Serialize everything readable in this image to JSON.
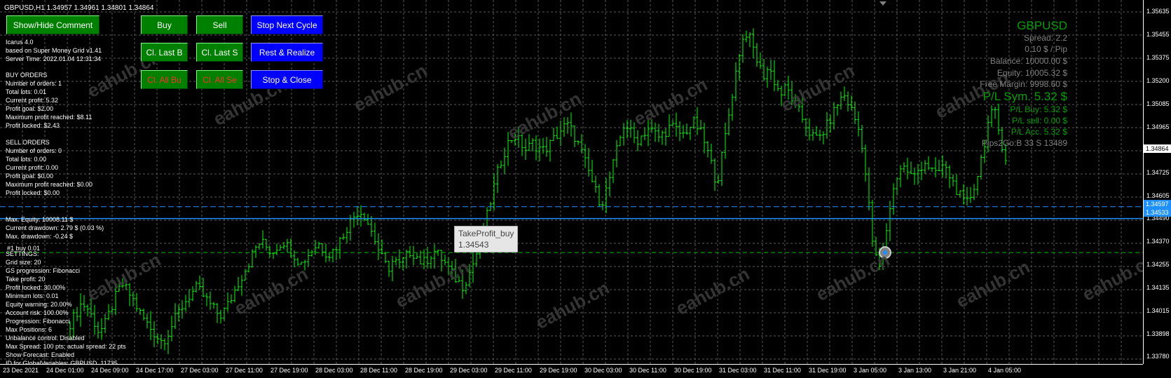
{
  "window": {
    "title": "GBPUSD,H1  1.34957 1.34961 1.34801 1.34864"
  },
  "buttons": {
    "show_hide_comment": "Show/Hide Comment",
    "buy": "Buy",
    "sell": "Sell",
    "stop_next_cycle": "Stop Next Cycle",
    "close_last_buy": "Cl. Last B",
    "close_last_sell": "Cl. Last S",
    "rest_realize": "Rest & Realize",
    "close_all_buy": "Cl. All Bu",
    "close_all_sell": "Cl. All Se",
    "stop_close": "Stop & Close"
  },
  "comment": {
    "header": [
      "Icarus 4.0",
      "based on Super Money Grid v1.41",
      "Server Time: 2022.01.04 12:31:34"
    ],
    "buy_orders": [
      "BUY ORDERS",
      "Number of orders: 1",
      "Total lots: 0.01",
      "Current profit: 5.32",
      "Profit goal: $2.00",
      "Maximum profit reached: $8.11",
      "Profit locked: $2.43"
    ],
    "sell_orders": [
      "SELL ORDERS",
      "Number of orders: 0",
      "Total lots: 0.00",
      "Current profit: 0.00",
      "Profit goal: $0.00",
      "Maximum profit reached: $0.00",
      "Profit locked: $0.00"
    ],
    "equity": [
      "Max. Equity: 10008.11 $",
      "Current drawdown: 2.79 $ (0.03 %)",
      "Max. drawdown: -0.24 $"
    ],
    "order_label": "#1 buy 0.01",
    "settings": [
      "SETTINGS:",
      "Grid size: 20",
      "GS progression: Fibonacci",
      "Take profit: 20",
      "Profit locked: 30.00%",
      "Minimum lots: 0.01",
      "Equity warning: 20.00%",
      "Account risk: 100.00%",
      "Progression: Fibonacci",
      "Max Positions: 6",
      "Unbalance control: Disabled",
      "Max Spread: 100 pts; actual spread: 22 pts",
      "Show Forecast: Enabled",
      "ID for GlobalVariables: GBPUSD_11735"
    ]
  },
  "info_panel": {
    "symbol": "GBPUSD",
    "spread": "Spread: 2.2",
    "pip_value": "0.10 $ / Pip",
    "balance": "Balance: 10000.00 $",
    "equity": "Equity: 10005.32 $",
    "free_margin": "Free Margin: 9998.60 $",
    "pl_sym": "P/L Sym. 5.32 $",
    "pl_buy": "P/L Buy: 5.32 $",
    "pl_sell": "P/L sell: 0.00 $",
    "pl_acc": "P/L Acc. 5.32 $",
    "pips2go": "Pips2Go:B 33 S 13489",
    "colors": {
      "symbol": "#00a000",
      "gray": "#808080",
      "green": "#00a000"
    }
  },
  "tooltip": {
    "title": "TakeProfit_buy",
    "value": "1.34543"
  },
  "watermark": "eahub.cn",
  "price_axis": {
    "ticks": [
      "1.35635",
      "1.35455",
      "1.35375",
      "1.35200",
      "1.35085",
      "1.34965",
      "1.34725",
      "1.34605",
      "1.34490",
      "1.34370",
      "1.34255",
      "1.34135",
      "1.34015",
      "1.33898",
      "1.33780"
    ],
    "current_price": "1.34864",
    "line1_label": "1.34597",
    "line2_label": "1.34533"
  },
  "time_axis": {
    "labels": [
      "23 Dec 2021",
      "24 Dec 01:00",
      "24 Dec 09:00",
      "24 Dec 17:00",
      "27 Dec 03:00",
      "27 Dec 11:00",
      "27 Dec 19:00",
      "28 Dec 03:00",
      "28 Dec 11:00",
      "28 Dec 19:00",
      "29 Dec 03:00",
      "29 Dec 11:00",
      "29 Dec 19:00",
      "30 Dec 03:00",
      "30 Dec 11:00",
      "30 Dec 19:00",
      "31 Dec 03:00",
      "31 Dec 11:00",
      "31 Dec 19:00",
      "3 Jan 05:00",
      "3 Jan 13:00",
      "3 Jan 21:00",
      "4 Jan 05:00"
    ]
  },
  "chart_data": {
    "type": "ohlc",
    "symbol": "GBPUSD",
    "timeframe": "H1",
    "ylim": [
      1.3375,
      1.3571
    ],
    "grid": true,
    "colors": {
      "bars": "#00ff00",
      "grid": "#5a5a5a",
      "line_upper": "#1e90ff",
      "line_lower": "#1e90ff",
      "order_line": "#00c000"
    },
    "levels": {
      "dashed_blue": 1.34597,
      "solid_blue": 1.34533,
      "order_line": 1.3435
    },
    "close_path": [
      1.3397,
      1.3402,
      1.3408,
      1.3405,
      1.3399,
      1.3392,
      1.3396,
      1.3404,
      1.3412,
      1.3418,
      1.3414,
      1.3409,
      1.3403,
      1.3398,
      1.3394,
      1.339,
      1.3387,
      1.3392,
      1.3398,
      1.3404,
      1.3409,
      1.3413,
      1.3416,
      1.3412,
      1.3408,
      1.3404,
      1.3401,
      1.3405,
      1.3411,
      1.3418,
      1.3424,
      1.343,
      1.3437,
      1.3441,
      1.3438,
      1.3435,
      1.3439,
      1.3441,
      1.3437,
      1.3433,
      1.3429,
      1.3433,
      1.3437,
      1.344,
      1.3436,
      1.3434,
      1.3438,
      1.3443,
      1.3449,
      1.3454,
      1.3458,
      1.3455,
      1.3448,
      1.344,
      1.3432,
      1.3426,
      1.3431,
      1.3428,
      1.3432,
      1.3436,
      1.3433,
      1.3429,
      1.3432,
      1.3436,
      1.3433,
      1.3429,
      1.3424,
      1.342,
      1.3417,
      1.3423,
      1.3431,
      1.344,
      1.3452,
      1.3465,
      1.3478,
      1.3488,
      1.3495,
      1.3498,
      1.3494,
      1.349,
      1.3494,
      1.3492,
      1.349,
      1.3493,
      1.3497,
      1.3501,
      1.3504,
      1.35,
      1.3493,
      1.3485,
      1.3477,
      1.3468,
      1.3461,
      1.347,
      1.3482,
      1.3494,
      1.3505,
      1.35,
      1.3495,
      1.3498,
      1.3502,
      1.35,
      1.3497,
      1.35,
      1.3503,
      1.3501,
      1.3498,
      1.3502,
      1.3505,
      1.3501,
      1.3493,
      1.3483,
      1.3472,
      1.3489,
      1.3508,
      1.3527,
      1.3545,
      1.3554,
      1.3548,
      1.3538,
      1.353,
      1.3535,
      1.3527,
      1.352,
      1.3524,
      1.3518,
      1.3512,
      1.3506,
      1.35,
      1.3496,
      1.3498,
      1.3503,
      1.3509,
      1.3516,
      1.352,
      1.3514,
      1.3506,
      1.3497,
      1.347,
      1.344,
      1.3425,
      1.344,
      1.346,
      1.3475,
      1.3482,
      1.3479,
      1.3475,
      1.348,
      1.3484,
      1.348,
      1.3476,
      1.3482,
      1.3478,
      1.3472,
      1.3466,
      1.346,
      1.3466,
      1.3475,
      1.3489,
      1.3505,
      1.3512,
      1.3498,
      1.3486
    ]
  }
}
